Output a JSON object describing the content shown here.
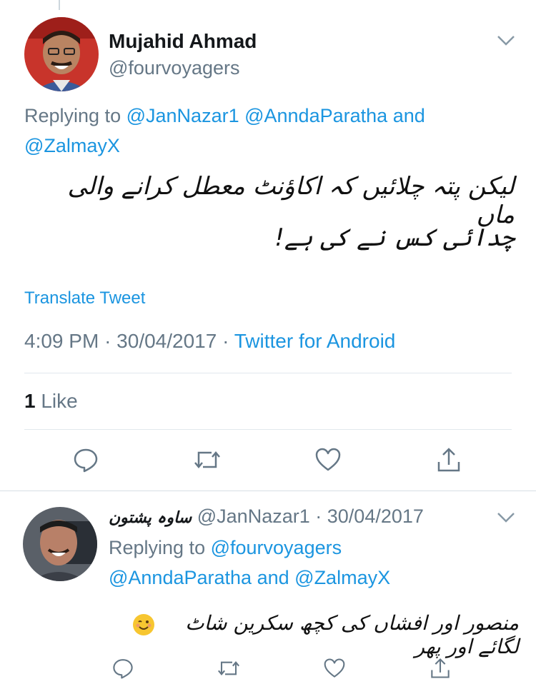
{
  "tweet1": {
    "author_name": "Mujahid Ahmad",
    "author_handle": "@fourvoyagers",
    "replying_prefix": "Replying to",
    "replying_to_1": "@JanNazar1",
    "replying_to_2": "@AnndaParatha",
    "replying_and": "and",
    "replying_to_3": "@ZalmayX",
    "body_line1": "لیکن پتہ چلائیں کہ اکاؤنٹ معطل کرانے والی ماں",
    "body_line2": "چدائی کس نے کی ہے!",
    "translate_label": "Translate Tweet",
    "time": "4:09 PM",
    "date": "30/04/2017",
    "separator": "·",
    "source": "Twitter for Android",
    "likes_count": "1",
    "likes_label": "Like"
  },
  "tweet2": {
    "author_name": "ساوہ پشتون",
    "author_handle": "@JanNazar1",
    "separator": "·",
    "date": "30/04/2017",
    "replying_prefix": "Replying to",
    "replying_to_1": "@fourvoyagers",
    "replying_to_2": "@AnndaParatha",
    "replying_and": "and",
    "replying_to_3": "@ZalmayX",
    "body": "منصور اور افشاں کی کچھ سکرین شاٹ لگائے اور پھر"
  },
  "icons": [
    "chevron-down-icon",
    "reply-icon",
    "retweet-icon",
    "like-icon",
    "share-icon",
    "wink-emoji-icon"
  ],
  "colors": {
    "link": "#1b95e0",
    "secondary": "#657786",
    "divider": "#e1e8ed"
  }
}
